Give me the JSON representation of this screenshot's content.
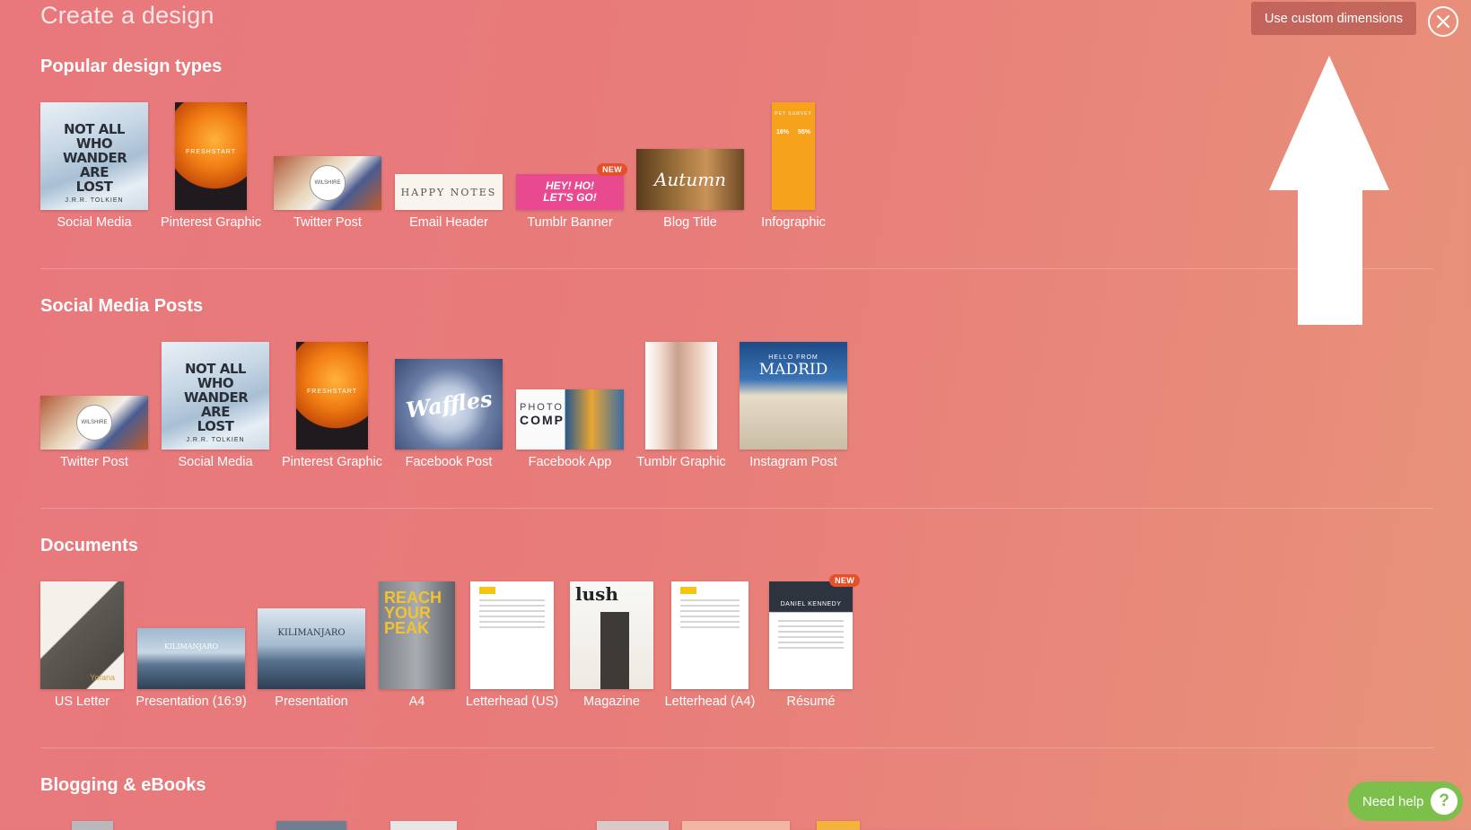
{
  "header": {
    "title": "Create a design",
    "custom_dimensions_label": "Use custom dimensions"
  },
  "sections": [
    {
      "title": "Popular design types",
      "items": [
        {
          "label": "Social Media"
        },
        {
          "label": "Pinterest Graphic"
        },
        {
          "label": "Twitter Post"
        },
        {
          "label": "Email Header"
        },
        {
          "label": "Tumblr Banner",
          "badge": "NEW"
        },
        {
          "label": "Blog Title"
        },
        {
          "label": "Infographic"
        }
      ]
    },
    {
      "title": "Social Media Posts",
      "items": [
        {
          "label": "Twitter Post"
        },
        {
          "label": "Social Media"
        },
        {
          "label": "Pinterest Graphic"
        },
        {
          "label": "Facebook Post"
        },
        {
          "label": "Facebook App"
        },
        {
          "label": "Tumblr Graphic"
        },
        {
          "label": "Instagram Post"
        }
      ]
    },
    {
      "title": "Documents",
      "items": [
        {
          "label": "US Letter"
        },
        {
          "label": "Presentation (16:9)"
        },
        {
          "label": "Presentation"
        },
        {
          "label": "A4"
        },
        {
          "label": "Letterhead (US)"
        },
        {
          "label": "Magazine"
        },
        {
          "label": "Letterhead (A4)"
        },
        {
          "label": "Résumé",
          "badge": "NEW"
        }
      ]
    },
    {
      "title": "Blogging & eBooks"
    }
  ],
  "thumb_text": {
    "wander": "NOT ALL WHO WANDER ARE LOST",
    "tolkien": "J.R.R. TOLKIEN",
    "freshstart": "FRESHSTART",
    "wilshire": "WILSHIRE",
    "happy_notes": "HAPPY NOTES",
    "hey_ho": "HEY! HO! LET'S GO!",
    "autumn": "Autumn",
    "pet_survey": "PET SURVEY",
    "pct1": "16%",
    "pct2": "55%",
    "waffles": "Waffles",
    "photo": "PHOTO",
    "comp": "COMP",
    "hello_from": "HELLO FROM",
    "madrid": "MADRID",
    "kilimanjaro": "KILIMANJARO",
    "reach": "REACH YOUR PEAK",
    "lush": "lush",
    "daniel": "DANIEL KENNEDY",
    "yofana": "Yofana"
  },
  "help": {
    "label": "Need help",
    "icon": "question-mark-icon"
  },
  "colors": {
    "background": "#e8787c",
    "help_green": "#7cc04b",
    "badge_red": "#e5502b"
  }
}
